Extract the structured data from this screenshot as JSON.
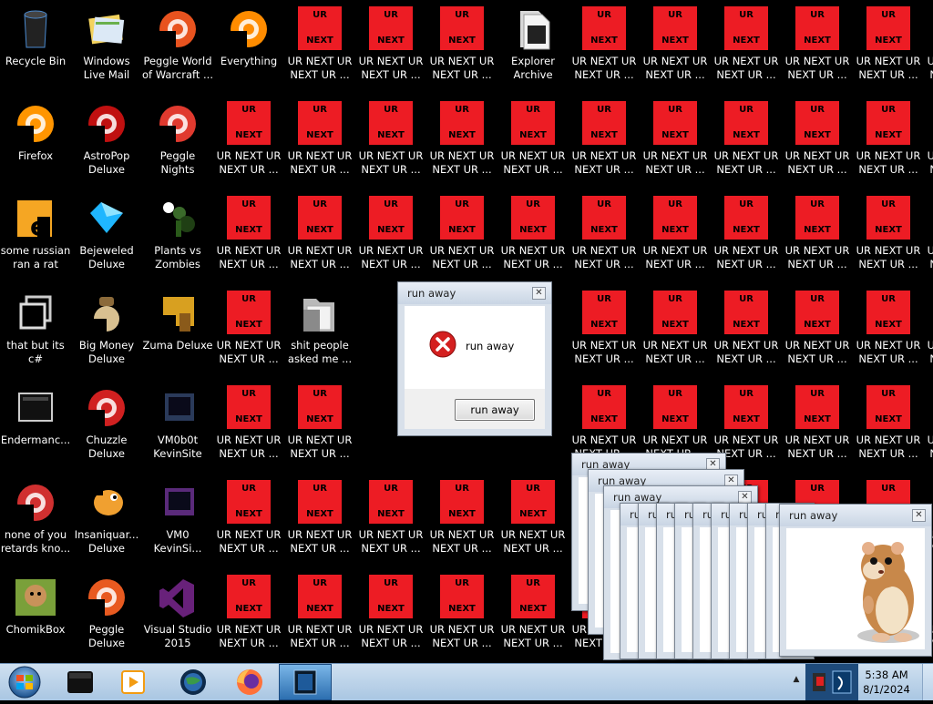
{
  "desktop": {
    "left_icons": [
      {
        "label": "Recycle Bin",
        "icon": "recycle-bin-icon",
        "color": "#3a3a3a"
      },
      {
        "label": "Windows Live Mail",
        "icon": "mail-icon",
        "color": "#6ab04c"
      },
      {
        "label": "Peggle World of Warcraft ...",
        "icon": "peggle-wow-icon",
        "color": "#e8531f"
      },
      {
        "label": "Everything",
        "icon": "search-icon",
        "color": "#ff8c00"
      },
      {
        "label": "Firefox",
        "icon": "firefox-icon",
        "color": "#ff9500"
      },
      {
        "label": "AstroPop Deluxe",
        "icon": "astropop-icon",
        "color": "#c01010"
      },
      {
        "label": "Peggle Nights Deluxe",
        "icon": "peggle-nights-icon",
        "color": "#e03a2f"
      },
      {
        "label": "some russian ran a rat",
        "icon": "file-icon",
        "color": "#f5a623"
      },
      {
        "label": "Bejeweled Deluxe",
        "icon": "gem-icon",
        "color": "#1fb6ff"
      },
      {
        "label": "Plants vs Zombies",
        "icon": "plant-icon",
        "color": "#4a8a2a"
      },
      {
        "label": "that but its c#",
        "icon": "shortcut-icon",
        "color": "#c0c0c0"
      },
      {
        "label": "Big Money Deluxe",
        "icon": "money-icon",
        "color": "#8b6a3a"
      },
      {
        "label": "Zuma Deluxe",
        "icon": "zuma-icon",
        "color": "#d8a020"
      },
      {
        "label": "Endermanc...",
        "icon": "app-icon",
        "color": "#555555"
      },
      {
        "label": "Chuzzle Deluxe",
        "icon": "chuzzle-icon",
        "color": "#d02020"
      },
      {
        "label": "VM0b0t KevinSite",
        "icon": "vm-icon",
        "color": "#2a3a5a"
      },
      {
        "label": "none of you retards kno...",
        "icon": "chrome-icon",
        "color": "#d03030"
      },
      {
        "label": "Insaniquar... Deluxe",
        "icon": "fish-icon",
        "color": "#f0a030"
      },
      {
        "label": "VM0 KevinSi...",
        "icon": "vm-icon",
        "color": "#5a2a7a"
      },
      {
        "label": "ChomikBox",
        "icon": "hamster-icon",
        "color": "#7aa03a"
      },
      {
        "label": "Peggle Deluxe",
        "icon": "peggle-icon",
        "color": "#e85a20"
      },
      {
        "label": "Visual Studio 2015",
        "icon": "visual-studio-icon",
        "color": "#68217a"
      }
    ],
    "ur_icon": {
      "top_text": "UR",
      "bottom_text": "NEXT",
      "label_line1": "UR NEXT UR",
      "label_line2": "NEXT UR ...",
      "color": "#ed1c24"
    },
    "explorer_icon": {
      "label": "Explorer Archive",
      "icon": "folder-archive-icon"
    },
    "folder_icon": {
      "label": "shit people asked me ...",
      "icon": "folder-icon"
    }
  },
  "dialog": {
    "title": "run away",
    "message": "run away",
    "button": "run away",
    "close": "✕"
  },
  "stacked_windows": {
    "title": "run away",
    "partial_title": "ru",
    "close": "✕"
  },
  "taskbar": {
    "time": "5:38 AM",
    "date": "8/1/2024",
    "apps": [
      "terminal-icon",
      "media-player-icon",
      "globe-icon",
      "firefox-icon",
      "window-switcher-icon"
    ]
  }
}
